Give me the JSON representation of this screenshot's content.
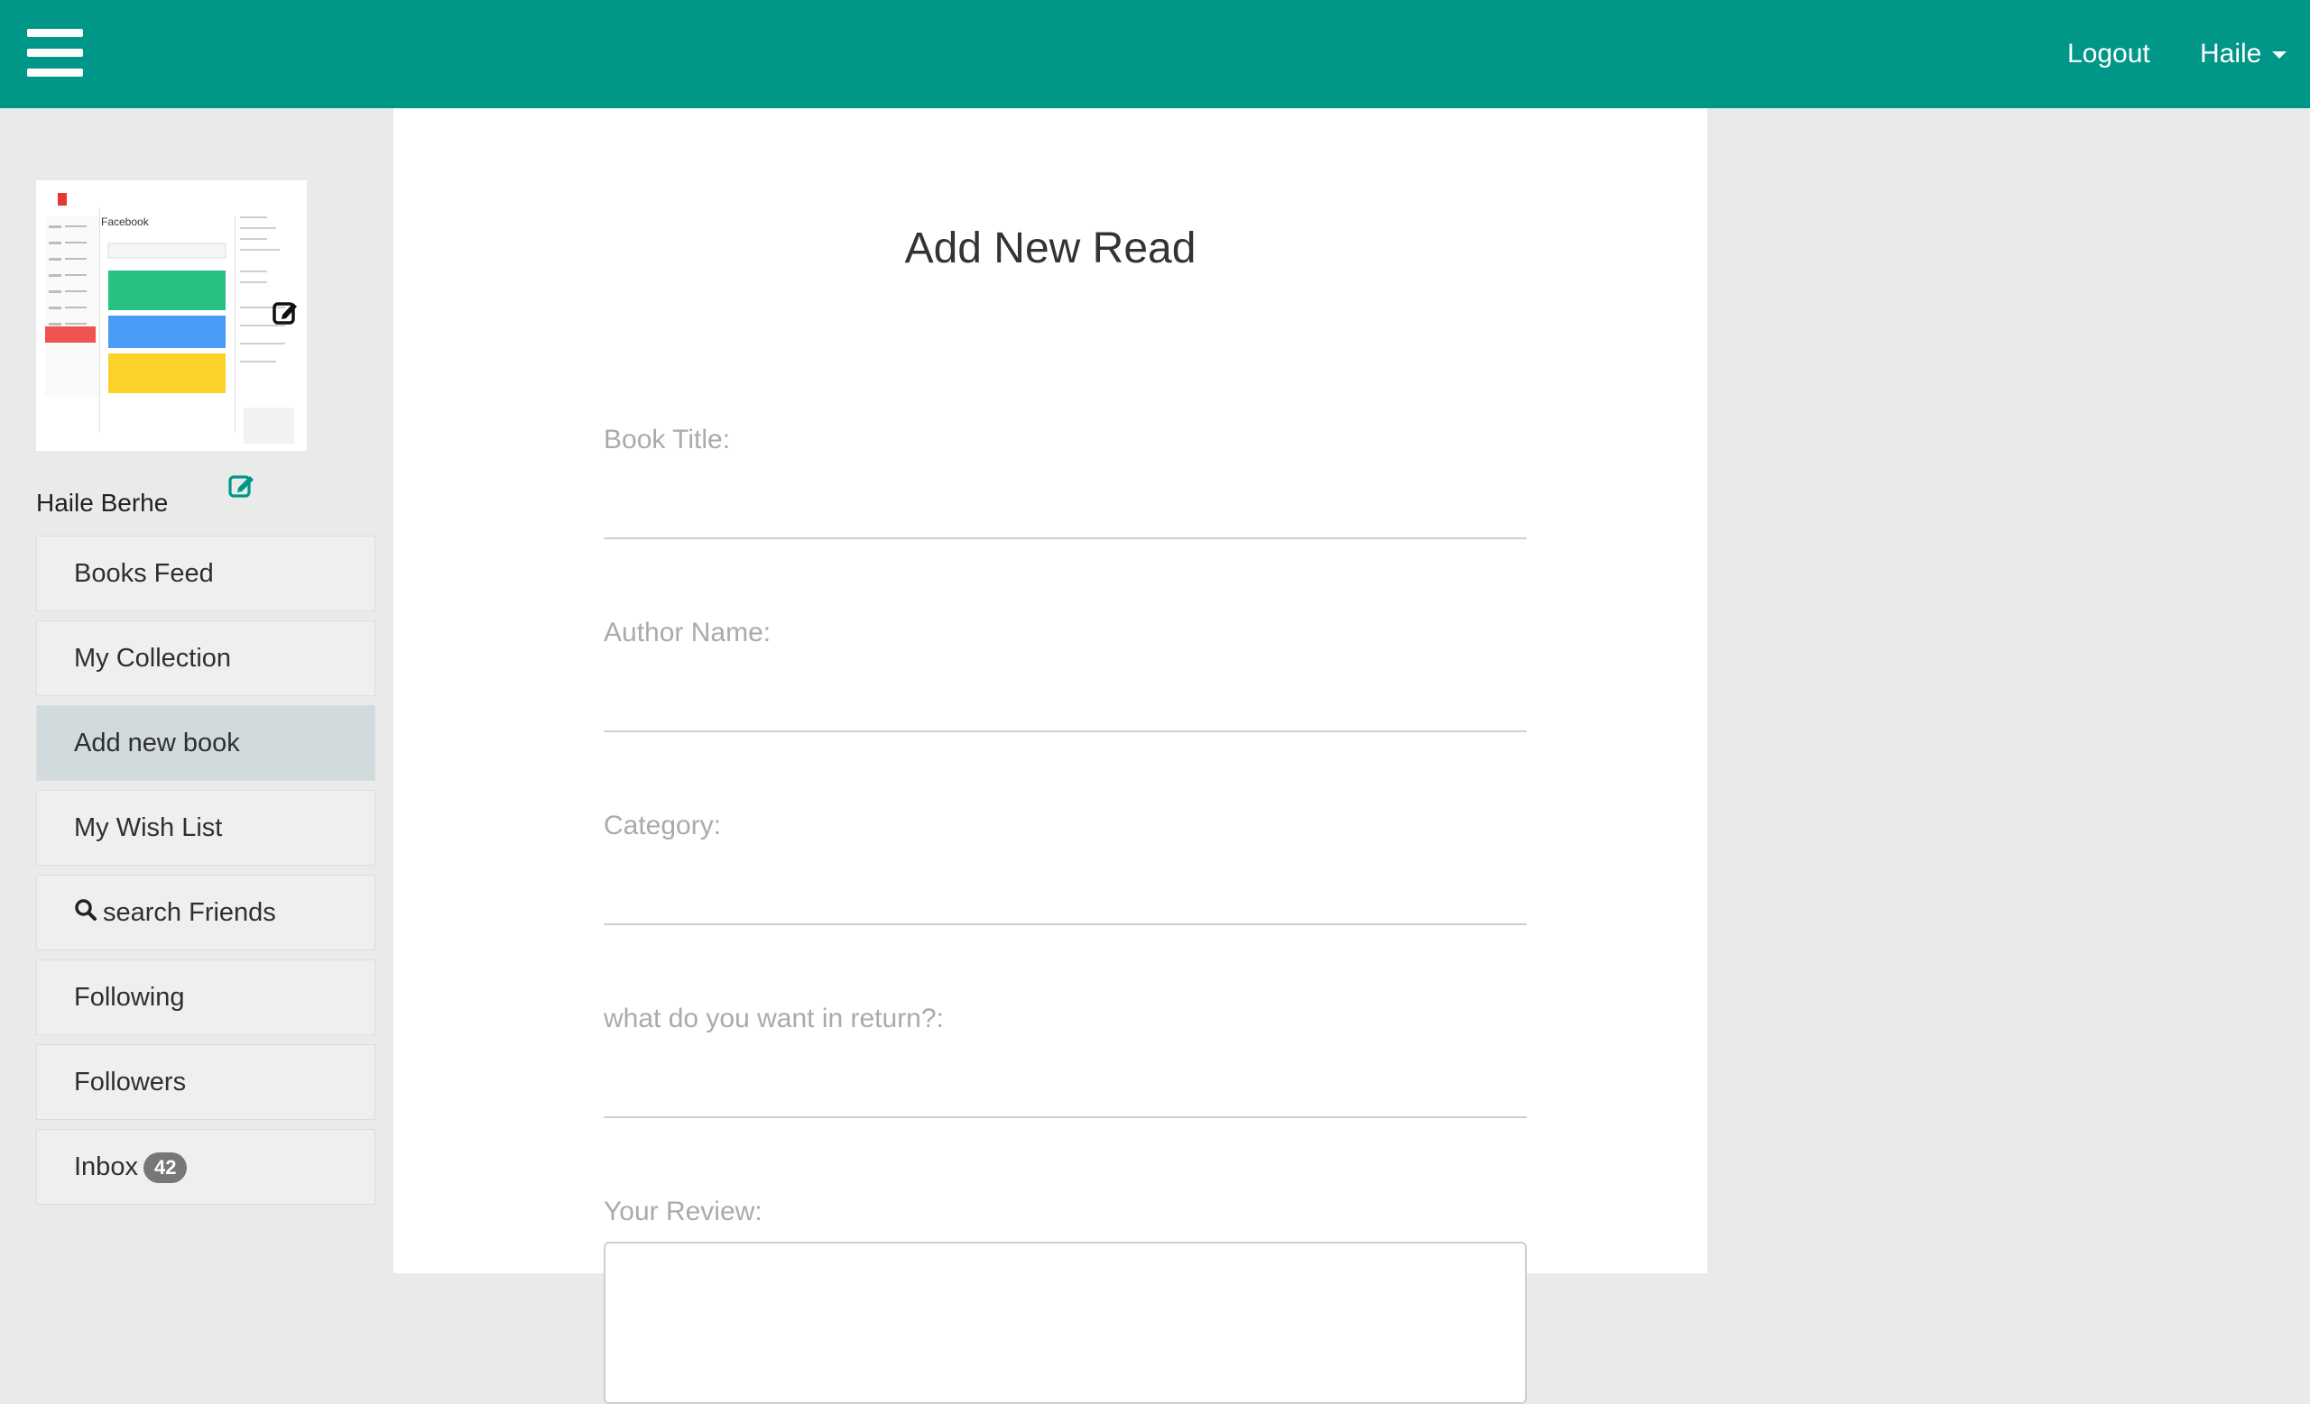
{
  "header": {
    "menu_icon": "hamburger-icon",
    "logout_label": "Logout",
    "user_label": "Haile",
    "bar_color": "#009688"
  },
  "profile": {
    "name": "Haile Berhe",
    "edit_icon": "edit-icon"
  },
  "sidebar": {
    "items": [
      {
        "label": "Books Feed"
      },
      {
        "label": "My Collection"
      },
      {
        "label": "Add new book",
        "active": true
      },
      {
        "label": "My Wish List"
      },
      {
        "label": "search Friends",
        "icon": "search-icon"
      },
      {
        "label": "Following"
      },
      {
        "label": "Followers"
      },
      {
        "label": "Inbox",
        "badge": "42"
      }
    ]
  },
  "form": {
    "title": "Add New Read",
    "fields": [
      {
        "label": "Book Title:",
        "value": ""
      },
      {
        "label": "Author Name:",
        "value": ""
      },
      {
        "label": "Category:",
        "value": ""
      },
      {
        "label": "what do you want in return?:",
        "value": ""
      }
    ],
    "review_label": "Your Review:",
    "review_value": ""
  },
  "thumbnail": {
    "heading": "Facebook"
  }
}
